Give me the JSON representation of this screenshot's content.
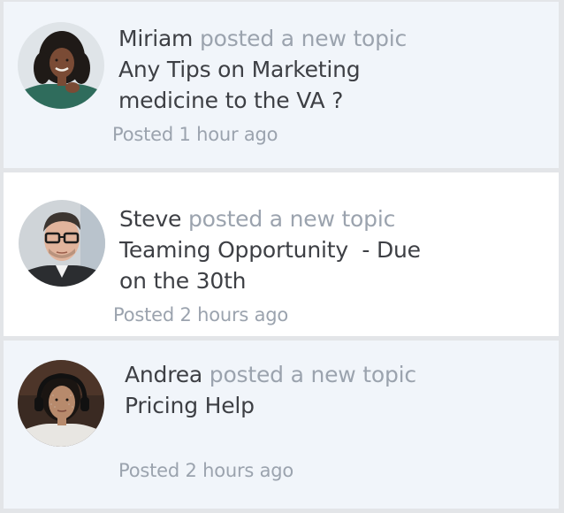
{
  "posts": [
    {
      "author": "Miriam",
      "action": "posted a new topic",
      "topic": "Any Tips on Marketing\nmedicine to the VA ?",
      "time": "Posted 1 hour ago"
    },
    {
      "author": "Steve",
      "action": "posted a new topic",
      "topic": "Teaming Opportunity  - Due\non the 30th",
      "time": "Posted 2 hours ago"
    },
    {
      "author": "Andrea",
      "action": "posted a new topic",
      "topic": "Pricing Help",
      "time": "Posted 2 hours ago"
    }
  ],
  "colors": {
    "text": "#3d3f44",
    "muted": "#9ba3ae",
    "card_tint": "#f1f5fa",
    "card_white": "#ffffff",
    "divider": "#e3e5e8"
  }
}
